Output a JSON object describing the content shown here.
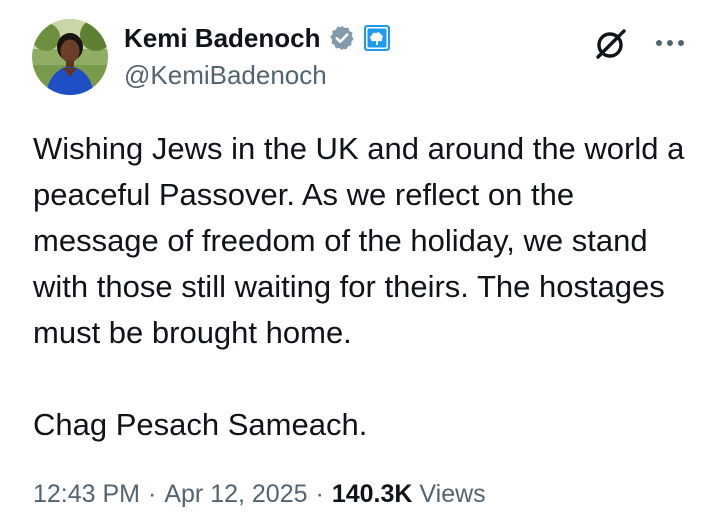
{
  "author": {
    "display_name": "Kemi Badenoch",
    "handle": "@KemiBadenoch",
    "verified_badge_icon": "verified-badge-icon",
    "affiliation_icon": "conservative-tree-logo-icon",
    "badge_color": "#829aab",
    "affiliation_color": "#1d9bf0"
  },
  "tweet": {
    "paragraphs": [
      "Wishing Jews in the UK and around the world a peaceful Passover. As we reflect on the message of freedom of the holiday, we stand with those still waiting for theirs. The hostages must be brought home.",
      "Chag Pesach Sameach."
    ],
    "time": "12:43 PM",
    "date": "Apr 12, 2025",
    "separator": "·",
    "views_count": "140.3K",
    "views_label": "Views"
  },
  "actions": {
    "grok_icon": "grok-icon",
    "more_icon": "more-options-icon"
  }
}
